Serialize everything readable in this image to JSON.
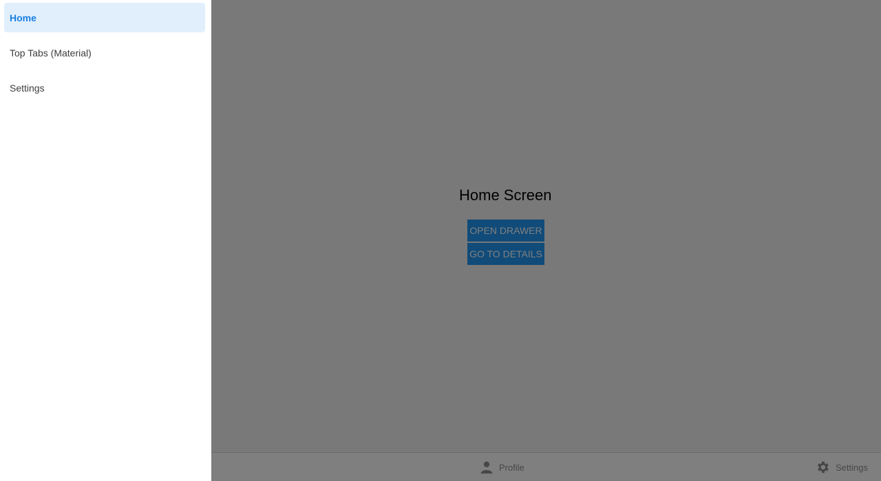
{
  "drawer": {
    "items": [
      {
        "label": "Home",
        "active": true
      },
      {
        "label": "Top Tabs (Material)",
        "active": false
      },
      {
        "label": "Settings",
        "active": false
      }
    ]
  },
  "main": {
    "title": "Home Screen",
    "buttons": {
      "open_drawer": "OPEN DRAWER",
      "go_to_details": "GO TO DETAILS"
    }
  },
  "tabbar": {
    "tabs": [
      {
        "label": "Profile",
        "icon": "person-icon"
      },
      {
        "label": "Settings",
        "icon": "gear-icon"
      }
    ]
  },
  "colors": {
    "accent": "#2196f3",
    "drawer_active_bg": "#e1effd",
    "drawer_active_text": "#1a7fe0",
    "overlay": "rgba(0,0,0,0.5)"
  }
}
